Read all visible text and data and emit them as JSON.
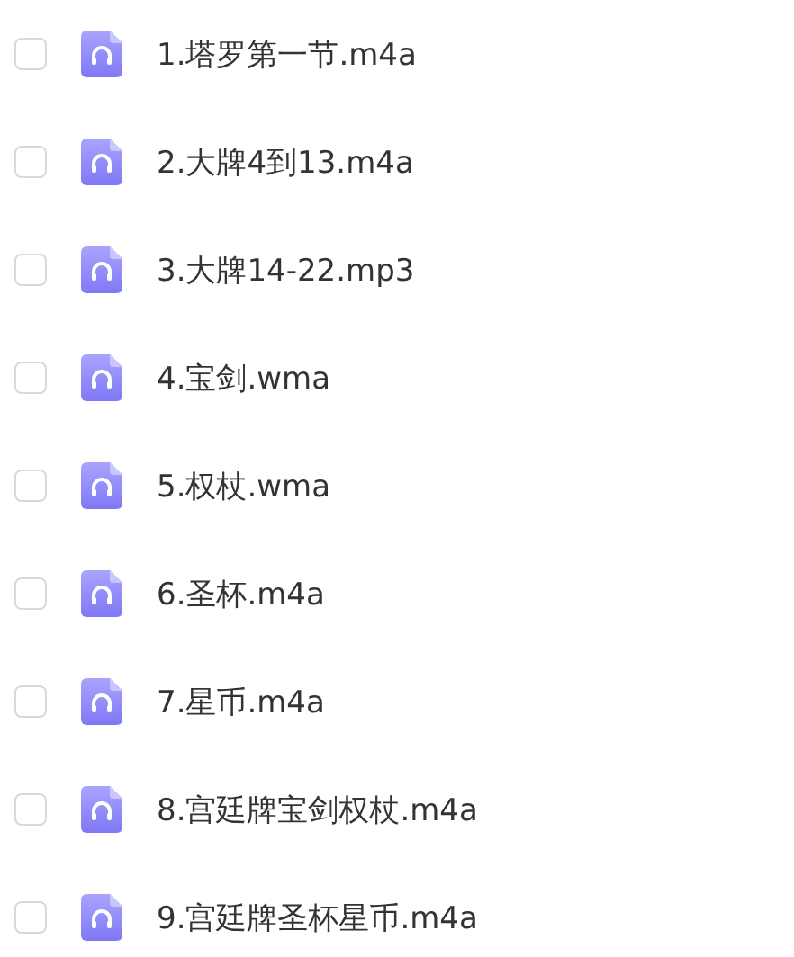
{
  "files": [
    {
      "name": "1.塔罗第一节.m4a",
      "checked": false
    },
    {
      "name": "2.大牌4到13.m4a",
      "checked": false
    },
    {
      "name": "3.大牌14-22.mp3",
      "checked": false
    },
    {
      "name": "4.宝剑.wma",
      "checked": false
    },
    {
      "name": "5.权杖.wma",
      "checked": false
    },
    {
      "name": "6.圣杯.m4a",
      "checked": false
    },
    {
      "name": "7.星币.m4a",
      "checked": false
    },
    {
      "name": "8.宫廷牌宝剑权杖.m4a",
      "checked": false
    },
    {
      "name": "9.宫廷牌圣杯星币.m4a",
      "checked": false
    }
  ]
}
